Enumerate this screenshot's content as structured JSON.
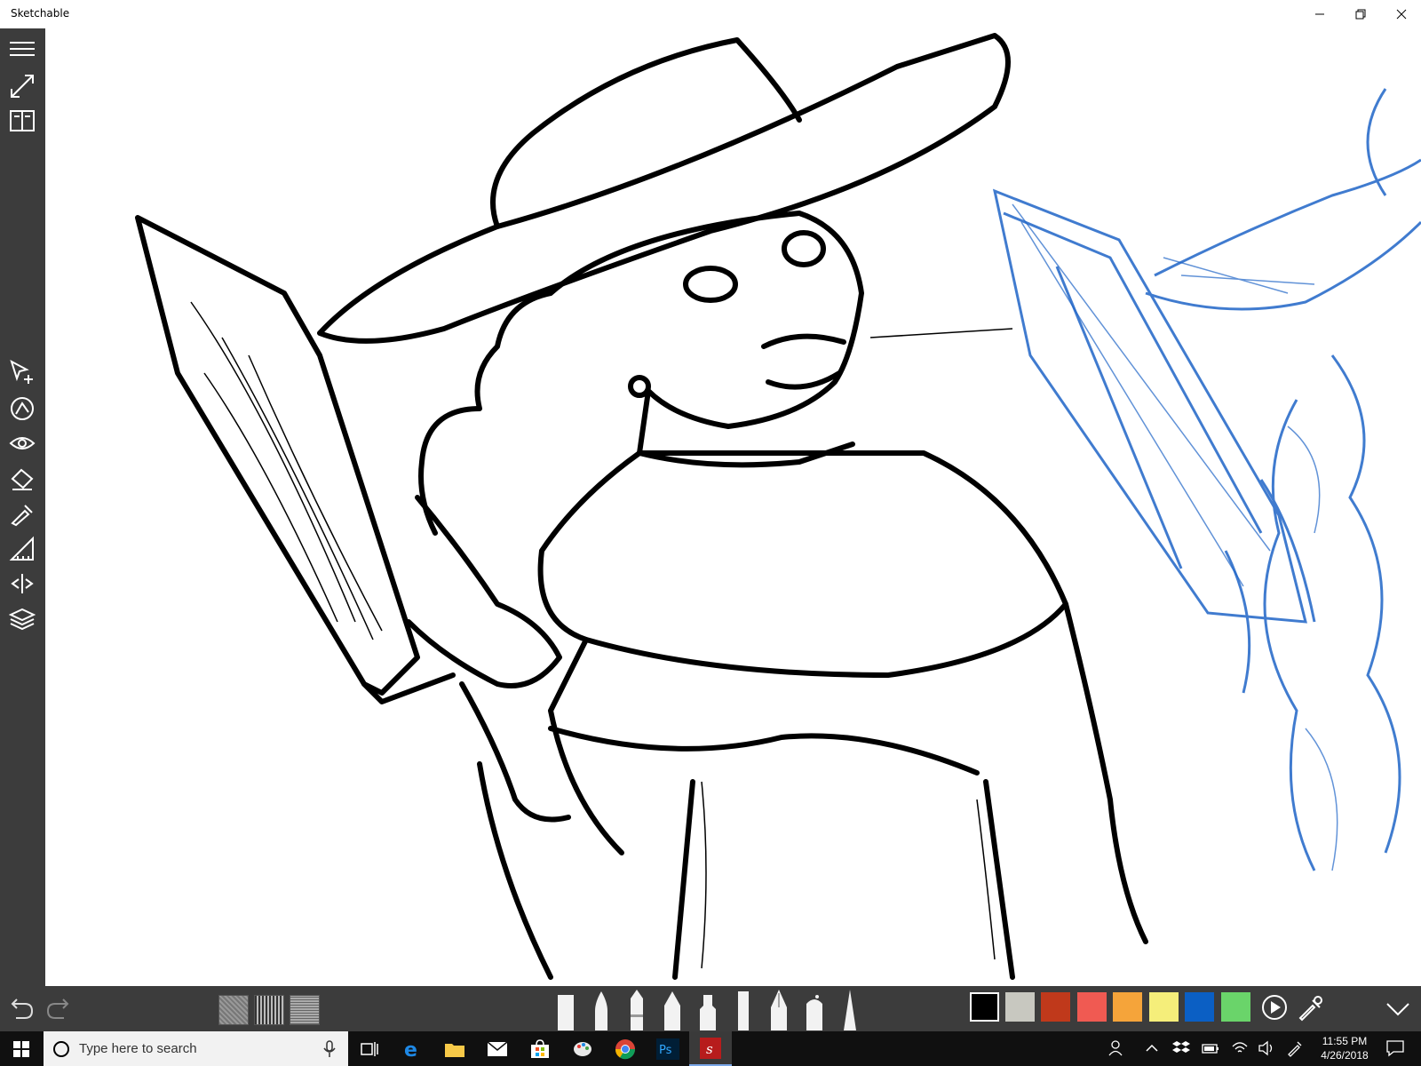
{
  "window": {
    "title": "Sketchable",
    "controls": [
      "minimize",
      "maximize",
      "close"
    ]
  },
  "sidebar": {
    "top_icons": [
      "menu-icon",
      "fullscreen-icon",
      "journal-icon"
    ],
    "tool_icons": [
      "select-move-icon",
      "rotate-canvas-icon",
      "visibility-icon",
      "fill-icon",
      "eyedropper-tool-icon",
      "ruler-icon",
      "symmetry-icon",
      "layers-icon"
    ]
  },
  "bottom_toolbar": {
    "history": [
      "undo-icon",
      "redo-icon"
    ],
    "textures": [
      "texture-1",
      "texture-2",
      "texture-3"
    ],
    "brushes": [
      "marker",
      "brush",
      "pencil",
      "pen",
      "highlighter",
      "felt-tip",
      "fountain-pen",
      "airbrush",
      "chalk"
    ],
    "colors": [
      "#000000",
      "#c8c8c0",
      "#c0391b",
      "#f05a52",
      "#f5a43a",
      "#f5ee7a",
      "#0b5fc4",
      "#6ad46a"
    ],
    "actions": [
      "play-icon",
      "color-picker-icon",
      "collapse-icon"
    ]
  },
  "taskbar": {
    "search_placeholder": "Type here to search",
    "apps": [
      "task-view",
      "edge",
      "file-explorer",
      "mail",
      "store",
      "paint",
      "chrome",
      "photoshop",
      "sketchable"
    ],
    "time": "11:55 PM",
    "date": "4/26/2018"
  }
}
